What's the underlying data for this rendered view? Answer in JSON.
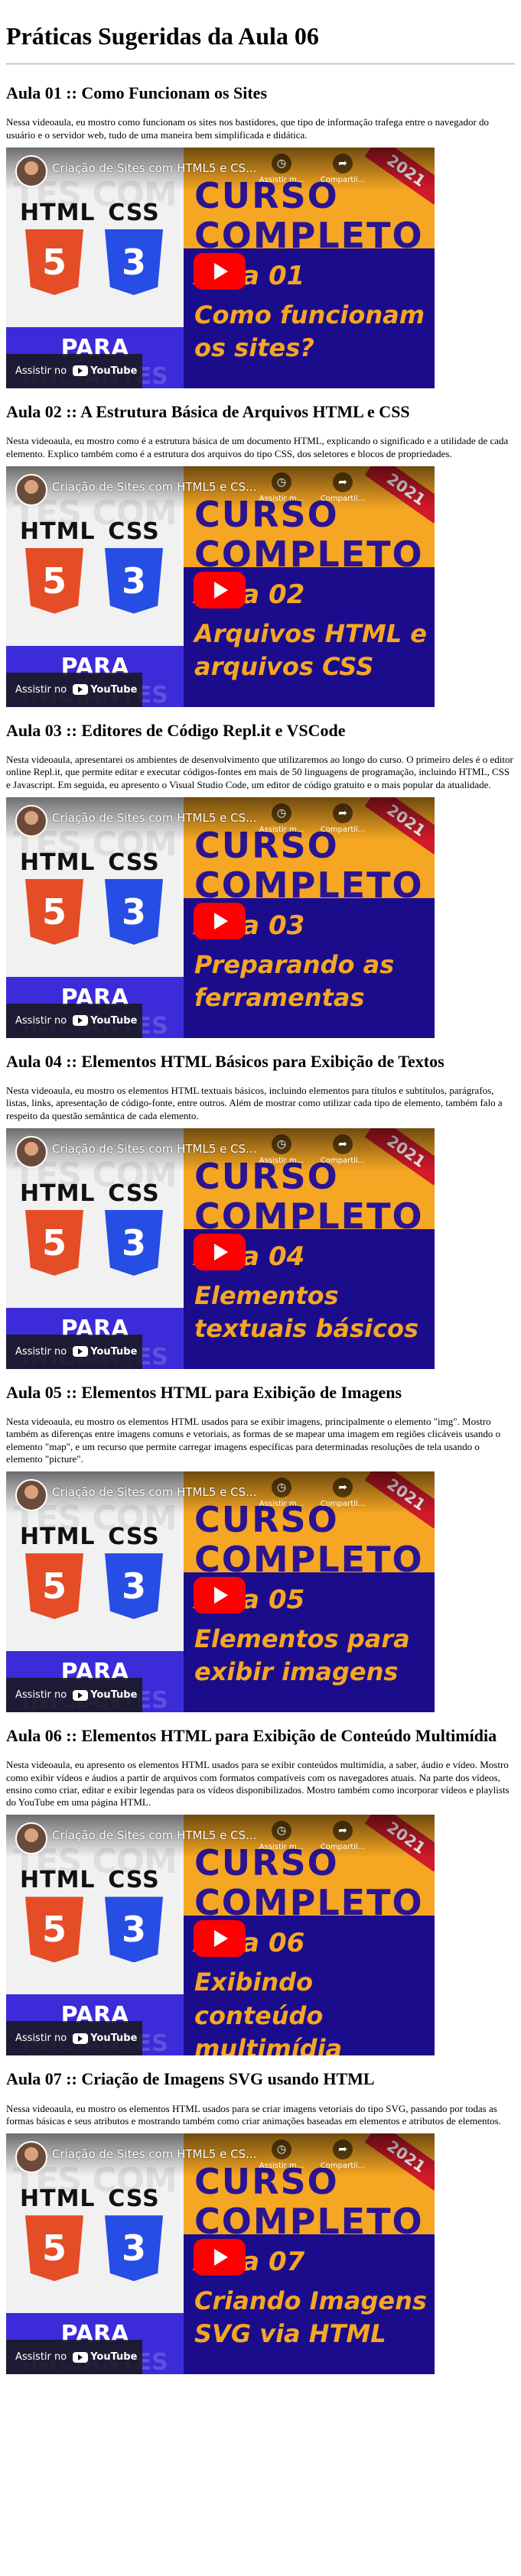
{
  "page": {
    "title": "Práticas Sugeridas da Aula 06"
  },
  "video_common": {
    "channel_title": "Criação de Sites com HTML5 e CS...",
    "watch_later": "Assistir m...",
    "share": "Compartil...",
    "watch_on": "Assistir no",
    "youtube": "YouTube",
    "bg_text": "TES COM",
    "html_label": "HTML",
    "css_label": "CSS",
    "html_digit": "5",
    "css_digit": "3",
    "para": "PARA",
    "ghost": "INICIANTES",
    "curso": "CURSO",
    "completo": "COMPLETO",
    "year": "2021"
  },
  "lessons": [
    {
      "heading": "Aula 01 :: Como Funcionam os Sites",
      "description": "Nessa videoaula, eu mostro como funcionam os sites nos bastidores, que tipo de informação trafega entre o navegador do usuário e o servidor web, tudo de uma maneira bem simplificada e didática.",
      "aula": "Aula 01",
      "subtitle": "Como funcionam os sites?"
    },
    {
      "heading": "Aula 02 :: A Estrutura Básica de Arquivos HTML e CSS",
      "description": "Nesta videoaula, eu mostro como é a estrutura básica de um documento HTML, explicando o significado e a utilidade de cada elemento. Explico também como é a estrutura dos arquivos do tipo CSS, dos seletores e blocos de propriedades.",
      "aula": "Aula 02",
      "subtitle": "Arquivos HTML e arquivos CSS"
    },
    {
      "heading": "Aula 03 :: Editores de Código Repl.it e VSCode",
      "description": "Nesta videoaula, apresentarei os ambientes de desenvolvimento que utilizaremos ao longo do curso. O primeiro deles é o editor online Repl.it, que permite editar e executar códigos-fontes em mais de 50 linguagens de programação, incluindo HTML, CSS e Javascript. Em seguida, eu apresento o Visual Studio Code, um editor de código gratuito e o mais popular da atualidade.",
      "aula": "Aula 03",
      "subtitle": "Preparando as ferramentas"
    },
    {
      "heading": "Aula 04 :: Elementos HTML Básicos para Exibição de Textos",
      "description": "Nesta videoaula, eu mostro os elementos HTML textuais básicos, incluindo elementos para títulos e subtítulos, parágrafos, listas, links, apresentação de código-fonte, entre outros. Além de mostrar como utilizar cada tipo de elemento, também falo a respeito da questão semântica de cada elemento.",
      "aula": "Aula 04",
      "subtitle": "Elementos textuais básicos"
    },
    {
      "heading": "Aula 05 :: Elementos HTML para Exibição de Imagens",
      "description": "Nesta videoaula, eu mostro os elementos HTML usados para se exibir imagens, principalmente o elemento \"img\". Mostro também as diferenças entre imagens comuns e vetoriais, as formas de se mapear uma imagem em regiões clicáveis usando o elemento \"map\", e um recurso que permite carregar imagens específicas para determinadas resoluções de tela usando o elemento \"picture\".",
      "aula": "Aula 05",
      "subtitle": "Elementos para exibir imagens"
    },
    {
      "heading": "Aula 06 :: Elementos HTML para Exibição de Conteúdo Multimídia",
      "description": "Nesta videoaula, eu apresento os elementos HTML usados para se exibir conteúdos multimídia, a saber, áudio e vídeo. Mostro como exibir vídeos e áudios a partir de arquivos com formatos compatíveis com os navegadores atuais. Na parte dos vídeos, ensino como criar, editar e exibir legendas para os vídeos disponibilizados. Mostro também como incorporar vídeos e playlists do YouTube em uma página HTML.",
      "aula": "Aula 06",
      "subtitle": "Exibindo conteúdo multimídia"
    },
    {
      "heading": "Aula 07 :: Criação de Imagens SVG usando HTML",
      "description": "Nessa videoaula, eu mostro os elementos HTML usados para se criar imagens vetoriais do tipo SVG, passando por todas as formas básicas e seus atributos e mostrando também como criar animações baseadas em elementos e atributos de elementos.",
      "aula": "Aula 07",
      "subtitle": "Criando Imagens SVG via HTML"
    }
  ]
}
